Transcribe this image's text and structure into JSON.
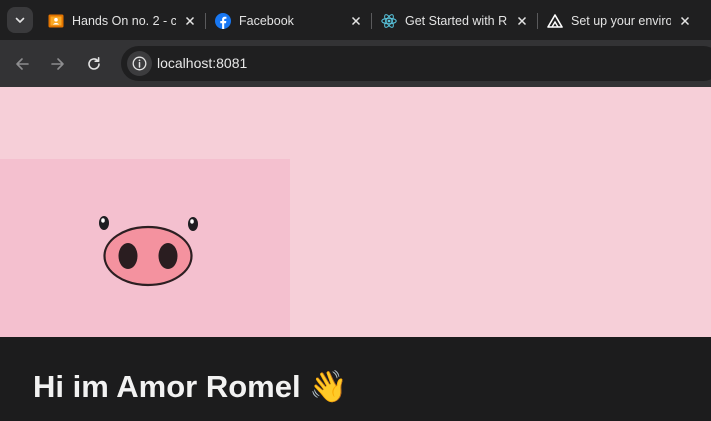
{
  "browser": {
    "tabs": [
      {
        "title": "Hands On no. 2 - c",
        "favicon": "classroom-icon",
        "favicon_color": "#e37400"
      },
      {
        "title": "Facebook",
        "favicon": "facebook-icon",
        "favicon_color": "#1877f2"
      },
      {
        "title": "Get Started with R",
        "favicon": "react-icon",
        "favicon_color": "#58c4dc"
      },
      {
        "title": "Set up your enviro",
        "favicon": "expo-icon",
        "favicon_color": "#ffffff"
      }
    ],
    "address_bar": {
      "url": "localhost:8081"
    }
  },
  "page": {
    "colors": {
      "background": "#f6cfd8",
      "image_background": "#f4c0cf",
      "footer": "#1c1c1d"
    },
    "hero_image": "pig-snout-illustration",
    "greeting": "Hi im Amor Romel",
    "greeting_emoji": "👋"
  }
}
